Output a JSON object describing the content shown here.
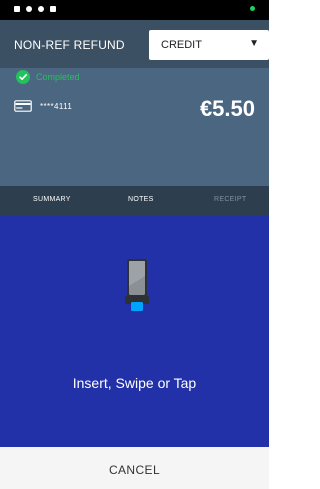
{
  "header": {
    "title": "NON-REF REFUND",
    "payment_type_select": {
      "value": "CREDIT",
      "chevron": "▼"
    }
  },
  "transaction": {
    "status": "Completed",
    "card_masked": "****4111",
    "amount": "€5.50"
  },
  "tabs": [
    {
      "label": "SUMMARY"
    },
    {
      "label": "NOTES"
    },
    {
      "label": "RECEIPT"
    }
  ],
  "main": {
    "prompt": "Insert, Swipe or Tap"
  },
  "footer": {
    "cancel_label": "CANCEL"
  },
  "colors": {
    "header_bg": "#3b5163",
    "panel_bg": "#4a6680",
    "tabs_bg": "#2d3f4f",
    "main_bg": "#2231a7",
    "completed_green": "#24c15d",
    "footer_bg": "#f5f5f5"
  },
  "icons": {
    "status_check": "check-circle-icon",
    "card": "credit-card-icon",
    "device": "card-reader-icon"
  }
}
